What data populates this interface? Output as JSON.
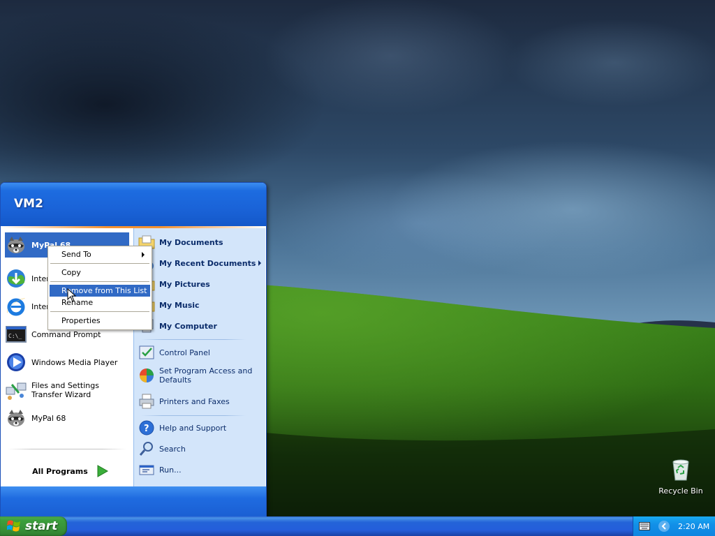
{
  "start_menu": {
    "user_name": "VM2",
    "pinned": [
      {
        "label": "MyPal 68",
        "icon": "raccoon-icon"
      },
      {
        "label": "Internet",
        "icon": "internet-download-icon"
      },
      {
        "label": "Internet",
        "icon": "internet-explorer-icon"
      }
    ],
    "recent": [
      {
        "label": "Command Prompt",
        "icon": "command-prompt-icon"
      },
      {
        "label": "Windows Media Player",
        "icon": "media-player-icon"
      },
      {
        "label": "Files and Settings Transfer Wizard",
        "icon": "transfer-wizard-icon"
      },
      {
        "label": "MyPal 68",
        "icon": "raccoon-icon"
      }
    ],
    "all_programs": "All Programs",
    "right_items": [
      {
        "label": "My Documents",
        "icon": "folder-documents-icon"
      },
      {
        "label": "My Recent Documents",
        "icon": "recent-documents-icon"
      },
      {
        "label": "My Pictures",
        "icon": "pictures-icon"
      },
      {
        "label": "My Music",
        "icon": "music-icon"
      },
      {
        "label": "My Computer",
        "icon": "computer-icon"
      },
      {
        "label": "Control Panel",
        "icon": "control-panel-icon"
      },
      {
        "label": "Set Program Access and Defaults",
        "icon": "program-access-icon"
      },
      {
        "label": "Printers and Faxes",
        "icon": "printer-icon"
      },
      {
        "label": "Help and Support",
        "icon": "help-icon"
      },
      {
        "label": "Search",
        "icon": "search-icon"
      },
      {
        "label": "Run...",
        "icon": "run-icon"
      }
    ]
  },
  "context_menu": {
    "items": [
      "Send To",
      "Copy",
      "Remove from This List",
      "Rename",
      "Properties"
    ],
    "highlighted": "Remove from This List"
  },
  "desktop": {
    "recycle_bin": "Recycle Bin"
  },
  "taskbar": {
    "start_label": "start",
    "clock": "2:20 AM"
  },
  "colors": {
    "start_menu_blue": "#1a63d8",
    "selection": "#316ac5",
    "right_pane": "#d3e5fa",
    "start_green": "#3c9f3c",
    "tray_blue": "#1290e8"
  }
}
